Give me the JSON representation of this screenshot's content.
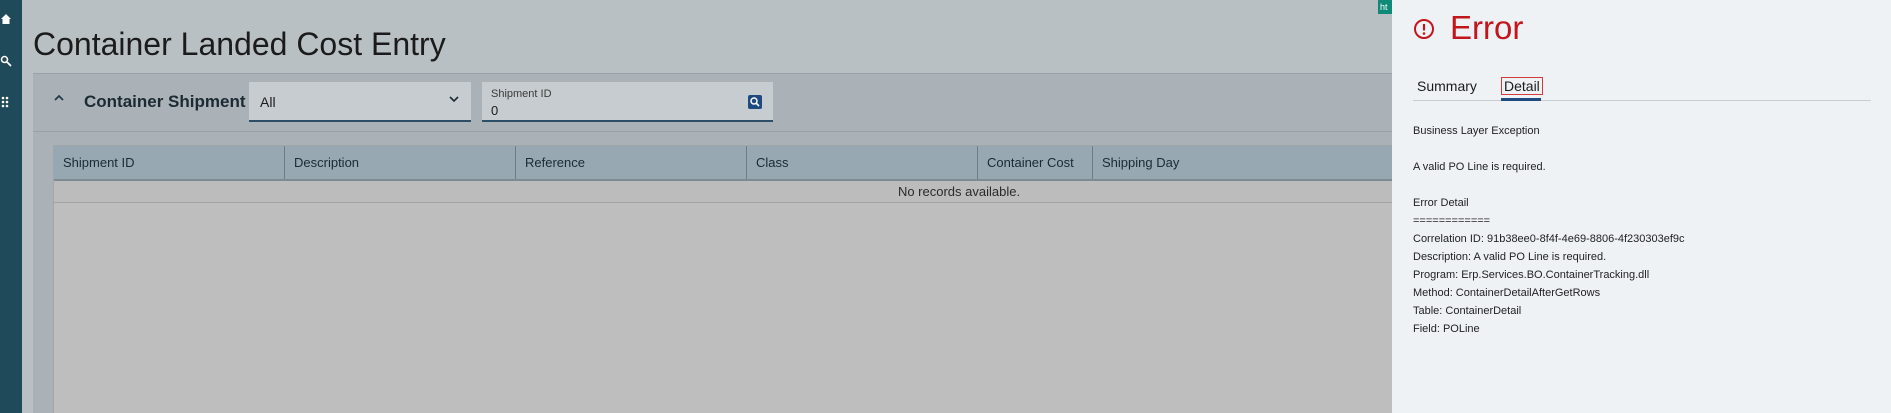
{
  "app": {
    "page_title": "Container Landed Cost Entry"
  },
  "nav": {
    "icons": [
      "home-icon",
      "search-icon",
      "apps-grid-icon"
    ]
  },
  "panel": {
    "title": "Container Shipment",
    "filter_select_value": "All",
    "shipment_id_label": "Shipment ID",
    "shipment_id_value": "0"
  },
  "grid": {
    "columns": [
      "Shipment ID",
      "Description",
      "Reference",
      "Class",
      "Container Cost",
      "Shipping Day"
    ],
    "empty_message": "No records available."
  },
  "env_tag": "ht",
  "error": {
    "title": "Error",
    "tabs": [
      "Summary",
      "Detail"
    ],
    "active_tab": "Detail",
    "lines": {
      "exception": "Business Layer Exception",
      "message": "A valid PO Line is required.",
      "detail_header": "Error Detail",
      "separator": "============",
      "correlation": "Correlation ID: 91b38ee0-8f4f-4e69-8806-4f230303ef9c",
      "description": "Description: A valid PO Line is required.",
      "program": "Program: Erp.Services.BO.ContainerTracking.dll",
      "method": "Method: ContainerDetailAfterGetRows",
      "table": "Table: ContainerDetail",
      "field": "Field: POLine"
    }
  },
  "colors": {
    "error_red": "#c0161c",
    "nav_rail": "#1f4a59",
    "accent_blue": "#1f4a80"
  }
}
